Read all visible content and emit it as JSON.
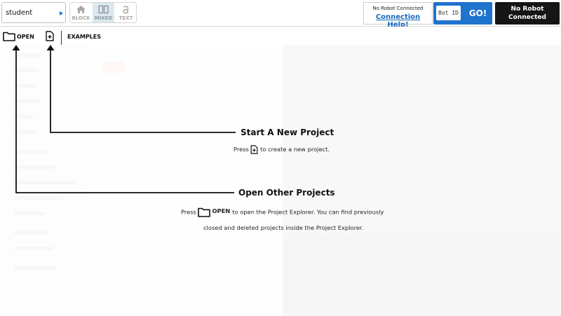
{
  "topbar": {
    "user_select_value": "student",
    "modes": [
      {
        "label": "BLOCK",
        "icon": "home-icon"
      },
      {
        "label": "MIXED",
        "icon": "split-view-icon",
        "active": true
      },
      {
        "label": "TEXT",
        "icon": "letter-a-icon"
      }
    ],
    "connection_status": "No Robot Connected",
    "connection_help": "Connection Help!",
    "bot_id_placeholder": "Bot ID",
    "go_label": "GO!",
    "robot_status_line1": "No Robot",
    "robot_status_line2": "Connected"
  },
  "toolbar": {
    "open_label": "OPEN",
    "examples_label": "EXAMPLES"
  },
  "tutorial": {
    "new_project_title": "Start A New Project",
    "new_project_text_before": "Press",
    "new_project_text_after": "to create a new project.",
    "open_projects_title": "Open Other Projects",
    "open_projects_text_before": "Press",
    "open_projects_open_word": "OPEN",
    "open_projects_text_after": "to open the Project Explorer. You can find previously",
    "open_projects_text_line2": "closed and deleted projects inside the Project Explorer."
  },
  "colors": {
    "accent_blue": "#1e73cc",
    "link_blue": "#1667b8",
    "dark_status": "#151515"
  }
}
